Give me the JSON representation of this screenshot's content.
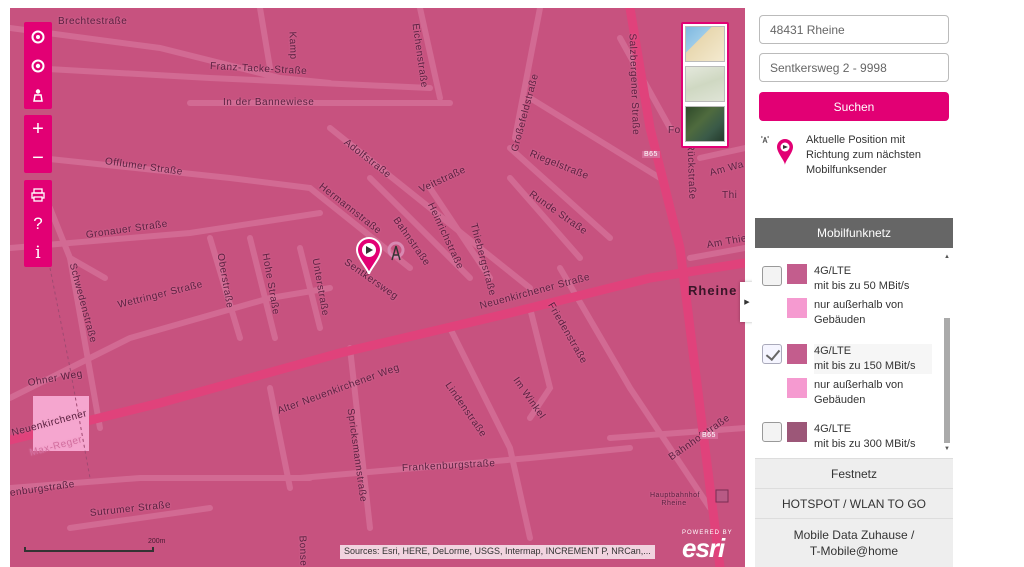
{
  "map": {
    "streets": [
      {
        "name": "Brechtestraße"
      },
      {
        "name": "Franz-Tacke-Straße"
      },
      {
        "name": "In der Bannewiese"
      },
      {
        "name": "Offlumer Straße"
      },
      {
        "name": "Gronauer Straße"
      },
      {
        "name": "Schwedenstraße"
      },
      {
        "name": "Wettringer Straße"
      },
      {
        "name": "Oberstraße"
      },
      {
        "name": "Hohe Straße"
      },
      {
        "name": "Unterstraße"
      },
      {
        "name": "Adolfstraße"
      },
      {
        "name": "Hermannstraße"
      },
      {
        "name": "Veitstraße"
      },
      {
        "name": "Heinrichstraße"
      },
      {
        "name": "Thiebergstraße"
      },
      {
        "name": "Bahnstraße"
      },
      {
        "name": "Sentkersweg"
      },
      {
        "name": "Großefeldstraße"
      },
      {
        "name": "Riegelstraße"
      },
      {
        "name": "Runde Straße"
      },
      {
        "name": "Neuenkirchener Straße"
      },
      {
        "name": "Friedenstraße"
      },
      {
        "name": "Alter Neuenkirchener Weg"
      },
      {
        "name": "Ohner Weg"
      },
      {
        "name": "Lindenstraße"
      },
      {
        "name": "Im Winkel"
      },
      {
        "name": "Spricksmannstraße"
      },
      {
        "name": "Frankenburgstraße"
      },
      {
        "name": "Salzbergener Straße"
      },
      {
        "name": "Eichenstraße"
      },
      {
        "name": "Sutrumer Straße"
      },
      {
        "name": "Bahnhofstraße"
      },
      {
        "name": "Am Thieto"
      },
      {
        "name": "Am Wa"
      },
      {
        "name": "Max-Reger"
      },
      {
        "name": "Neuenkirchener"
      },
      {
        "name": "Kamp"
      },
      {
        "name": "Rückstraße"
      },
      {
        "name": "Bonse"
      },
      {
        "name": "Fo"
      },
      {
        "name": "Thi"
      },
      {
        "name": "enburgstraße"
      },
      {
        "name": "B65"
      },
      {
        "name": "B65"
      },
      {
        "name": "Hauptbahnhof Rheine"
      }
    ],
    "city_label": "Rheine",
    "attribution": "Sources: Esri, HERE, DeLorme, USGS, Intermap, INCREMENT P, NRCan,...",
    "esri_powered": "POWERED BY",
    "esri_logo": "esri",
    "scale_label": "200m",
    "toolbar_icons": [
      "locate-icon",
      "target-icon",
      "person-icon",
      "zoom-in-icon",
      "zoom-out-icon",
      "print-icon",
      "help-icon",
      "info-icon"
    ],
    "toolbar_glyphs": {
      "zoom_in": "+",
      "zoom_out": "−",
      "help": "?",
      "info": "i"
    },
    "colors": {
      "background": "#c7527f",
      "road": "#d26a93",
      "major_road": "#e0427b",
      "accent": "#e20074"
    }
  },
  "search": {
    "city_value": "48431 Rheine",
    "street_value": "Sentkersweg 2 - 9998",
    "button_label": "Suchen"
  },
  "legend_position": {
    "text": "Aktuelle Position mit Richtung zum nächsten Mobilfunksender"
  },
  "mobilfunk": {
    "header": "Mobilfunknetz",
    "layers": [
      {
        "title": "4G/LTE",
        "subtitle": "mit bis zu 50 MBit/s",
        "checked": false,
        "color": "#c35d8d",
        "sub_color": "#f59ad0",
        "sub_label": "nur außerhalb von Gebäuden"
      },
      {
        "title": "4G/LTE",
        "subtitle": "mit bis zu 150 MBit/s",
        "checked": true,
        "color": "#c35d8d",
        "sub_color": "#f59ad0",
        "sub_label": "nur außerhalb von Gebäuden"
      },
      {
        "title": "4G/LTE",
        "subtitle": "mit bis zu 300 MBit/s",
        "checked": false,
        "color": "#9c5778"
      }
    ]
  },
  "tabs": {
    "festnetz": "Festnetz",
    "hotspot": "HOTSPOT / WLAN TO GO",
    "mobile_data_1": "Mobile Data Zuhause /",
    "mobile_data_2": "T-Mobile@home"
  }
}
